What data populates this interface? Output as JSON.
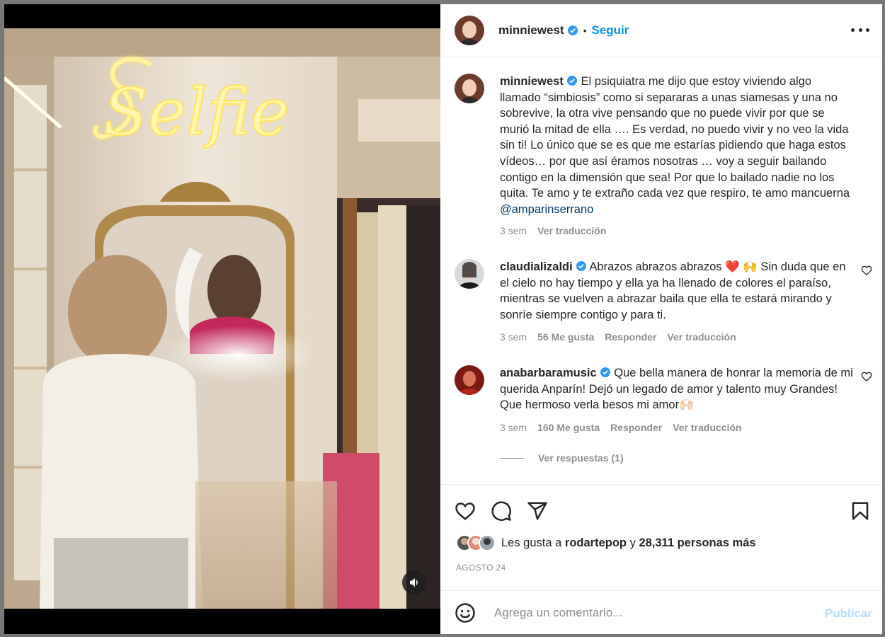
{
  "post": {
    "author": "minniewest",
    "follow_label": "Seguir",
    "separator": "•"
  },
  "media": {
    "neon_text": "Selfie"
  },
  "caption": {
    "username": "minniewest",
    "text": "El psiquiatra me dijo que estoy viviendo algo llamado “simbiosis” como si separaras a unas siamesas y una no sobrevive, la otra vive pensando que no puede vivir por que se murió la mitad de ella …. Es verdad, no puedo vivir y no veo la vida sin ti! Lo único que se es que me estarías pidiendo que haga estos vídeos… por que así éramos nosotras … voy a seguir bailando contigo en la dimensión que sea! Por que lo bailado nadie no los quita. Te amo y te extraño cada vez que respiro, te amo mancuerna",
    "mention": "@amparinserrano",
    "time": "3 sem",
    "translate": "Ver traducción"
  },
  "comments": [
    {
      "username": "claudializaldi",
      "text": "Abrazos abrazos abrazos ❤️ 🙌  Sin duda que en el cielo no hay tiempo y ella ya ha llenado de colores el paraíso, mientras se vuelven a abrazar baila que ella te estará mirando y sonríe siempre contigo y para ti.",
      "time": "3 sem",
      "likes": "56 Me gusta",
      "reply": "Responder",
      "translate": "Ver traducción"
    },
    {
      "username": "anabarbaramusic",
      "text": "Que bella manera de honrar la memoria de mi querida Anparín! Dejó un legado de amor y talento muy Grandes! Que hermoso verla besos mi amor🙌🏻",
      "time": "3 sem",
      "likes": "160 Me gusta",
      "reply": "Responder",
      "translate": "Ver traducción",
      "view_replies": "Ver respuestas (1)"
    }
  ],
  "likes": {
    "prefix": "Les gusta a",
    "user": "rodartepop",
    "conj": "y",
    "others": "28,311 personas más"
  },
  "date": "AGOSTO 24",
  "composer": {
    "placeholder": "Agrega un comentario...",
    "publish_label": "Publicar"
  },
  "icons": {
    "like": "heart-icon",
    "comment": "comment-icon",
    "share": "share-icon",
    "save": "bookmark-icon",
    "emoji": "emoji-icon",
    "mute": "speaker-icon",
    "more": "more-icon",
    "verified": "verified-badge-icon"
  },
  "colors": {
    "accent": "#0095f6",
    "verified": "#3897f0",
    "publish_disabled": "#b3dbff",
    "muted_text": "#8e8e8e",
    "text": "#262626"
  }
}
